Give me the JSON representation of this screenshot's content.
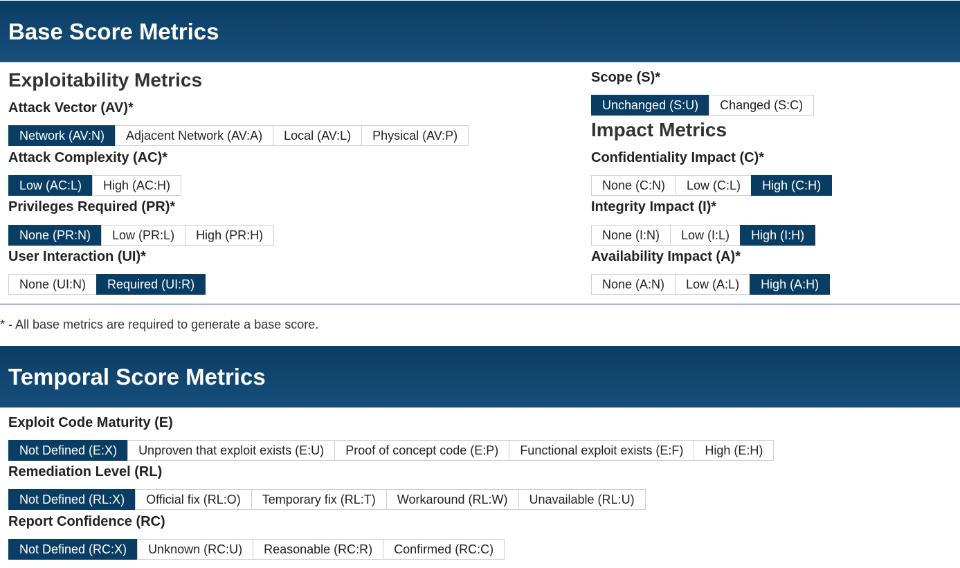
{
  "base": {
    "title": "Base Score Metrics",
    "exploitability_title": "Exploitability Metrics",
    "impact_title": "Impact Metrics",
    "metrics": {
      "av": {
        "label": "Attack Vector (AV)*",
        "options": [
          "Network (AV:N)",
          "Adjacent Network (AV:A)",
          "Local (AV:L)",
          "Physical (AV:P)"
        ],
        "selected": 0
      },
      "ac": {
        "label": "Attack Complexity (AC)*",
        "options": [
          "Low (AC:L)",
          "High (AC:H)"
        ],
        "selected": 0
      },
      "pr": {
        "label": "Privileges Required (PR)*",
        "options": [
          "None (PR:N)",
          "Low (PR:L)",
          "High (PR:H)"
        ],
        "selected": 0
      },
      "ui": {
        "label": "User Interaction (UI)*",
        "options": [
          "None (UI:N)",
          "Required (UI:R)"
        ],
        "selected": 1
      },
      "s": {
        "label": "Scope (S)*",
        "options": [
          "Unchanged (S:U)",
          "Changed (S:C)"
        ],
        "selected": 0
      },
      "c": {
        "label": "Confidentiality Impact (C)*",
        "options": [
          "None (C:N)",
          "Low (C:L)",
          "High (C:H)"
        ],
        "selected": 2
      },
      "i": {
        "label": "Integrity Impact (I)*",
        "options": [
          "None (I:N)",
          "Low (I:L)",
          "High (I:H)"
        ],
        "selected": 2
      },
      "a": {
        "label": "Availability Impact (A)*",
        "options": [
          "None (A:N)",
          "Low (A:L)",
          "High (A:H)"
        ],
        "selected": 2
      }
    },
    "note": "* - All base metrics are required to generate a base score."
  },
  "temporal": {
    "title": "Temporal Score Metrics",
    "metrics": {
      "e": {
        "label": "Exploit Code Maturity (E)",
        "options": [
          "Not Defined (E:X)",
          "Unproven that exploit exists (E:U)",
          "Proof of concept code (E:P)",
          "Functional exploit exists (E:F)",
          "High (E:H)"
        ],
        "selected": 0
      },
      "rl": {
        "label": "Remediation Level (RL)",
        "options": [
          "Not Defined (RL:X)",
          "Official fix (RL:O)",
          "Temporary fix (RL:T)",
          "Workaround (RL:W)",
          "Unavailable (RL:U)"
        ],
        "selected": 0
      },
      "rc": {
        "label": "Report Confidence (RC)",
        "options": [
          "Not Defined (RC:X)",
          "Unknown (RC:U)",
          "Reasonable (RC:R)",
          "Confirmed (RC:C)"
        ],
        "selected": 0
      }
    }
  },
  "colors": {
    "header": "#0a3d63",
    "active": "#0a3d63",
    "border": "#cfcfcf"
  }
}
